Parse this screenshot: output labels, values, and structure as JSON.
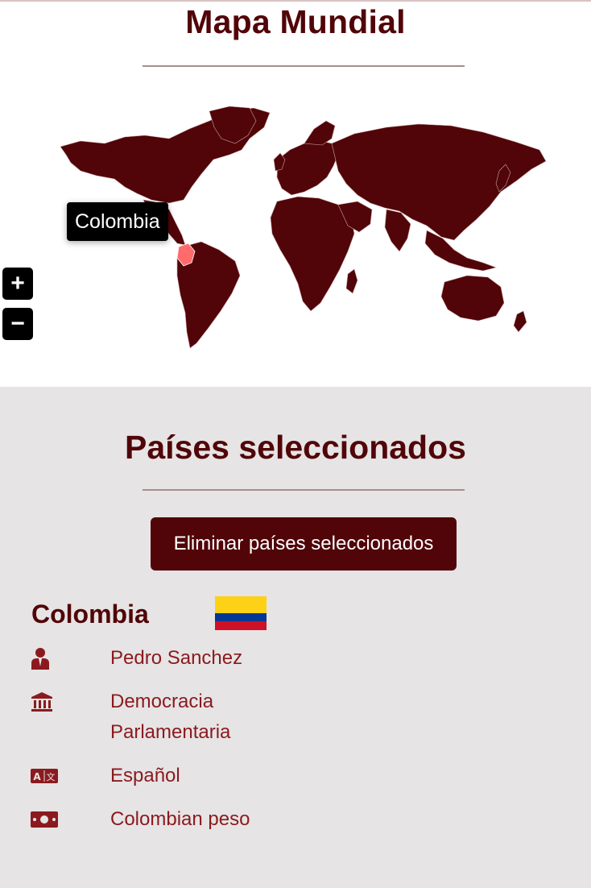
{
  "map": {
    "title": "Mapa Mundial",
    "tooltip": "Colombia",
    "zoom_in_label": "+",
    "zoom_out_label": "−",
    "land_color": "#510508",
    "highlight_color": "#ff6b6b"
  },
  "selected": {
    "title": "Países seleccionados",
    "remove_label": "Eliminar países seleccionados",
    "country": {
      "name": "Colombia",
      "leader": "Pedro Sanchez",
      "government_line1": "Democracia",
      "government_line2": "Parlamentaria",
      "language": "Español",
      "currency": "Colombian peso"
    },
    "icons": [
      "person-suit-icon",
      "landmark-icon",
      "translate-icon",
      "money-bill-icon"
    ]
  }
}
